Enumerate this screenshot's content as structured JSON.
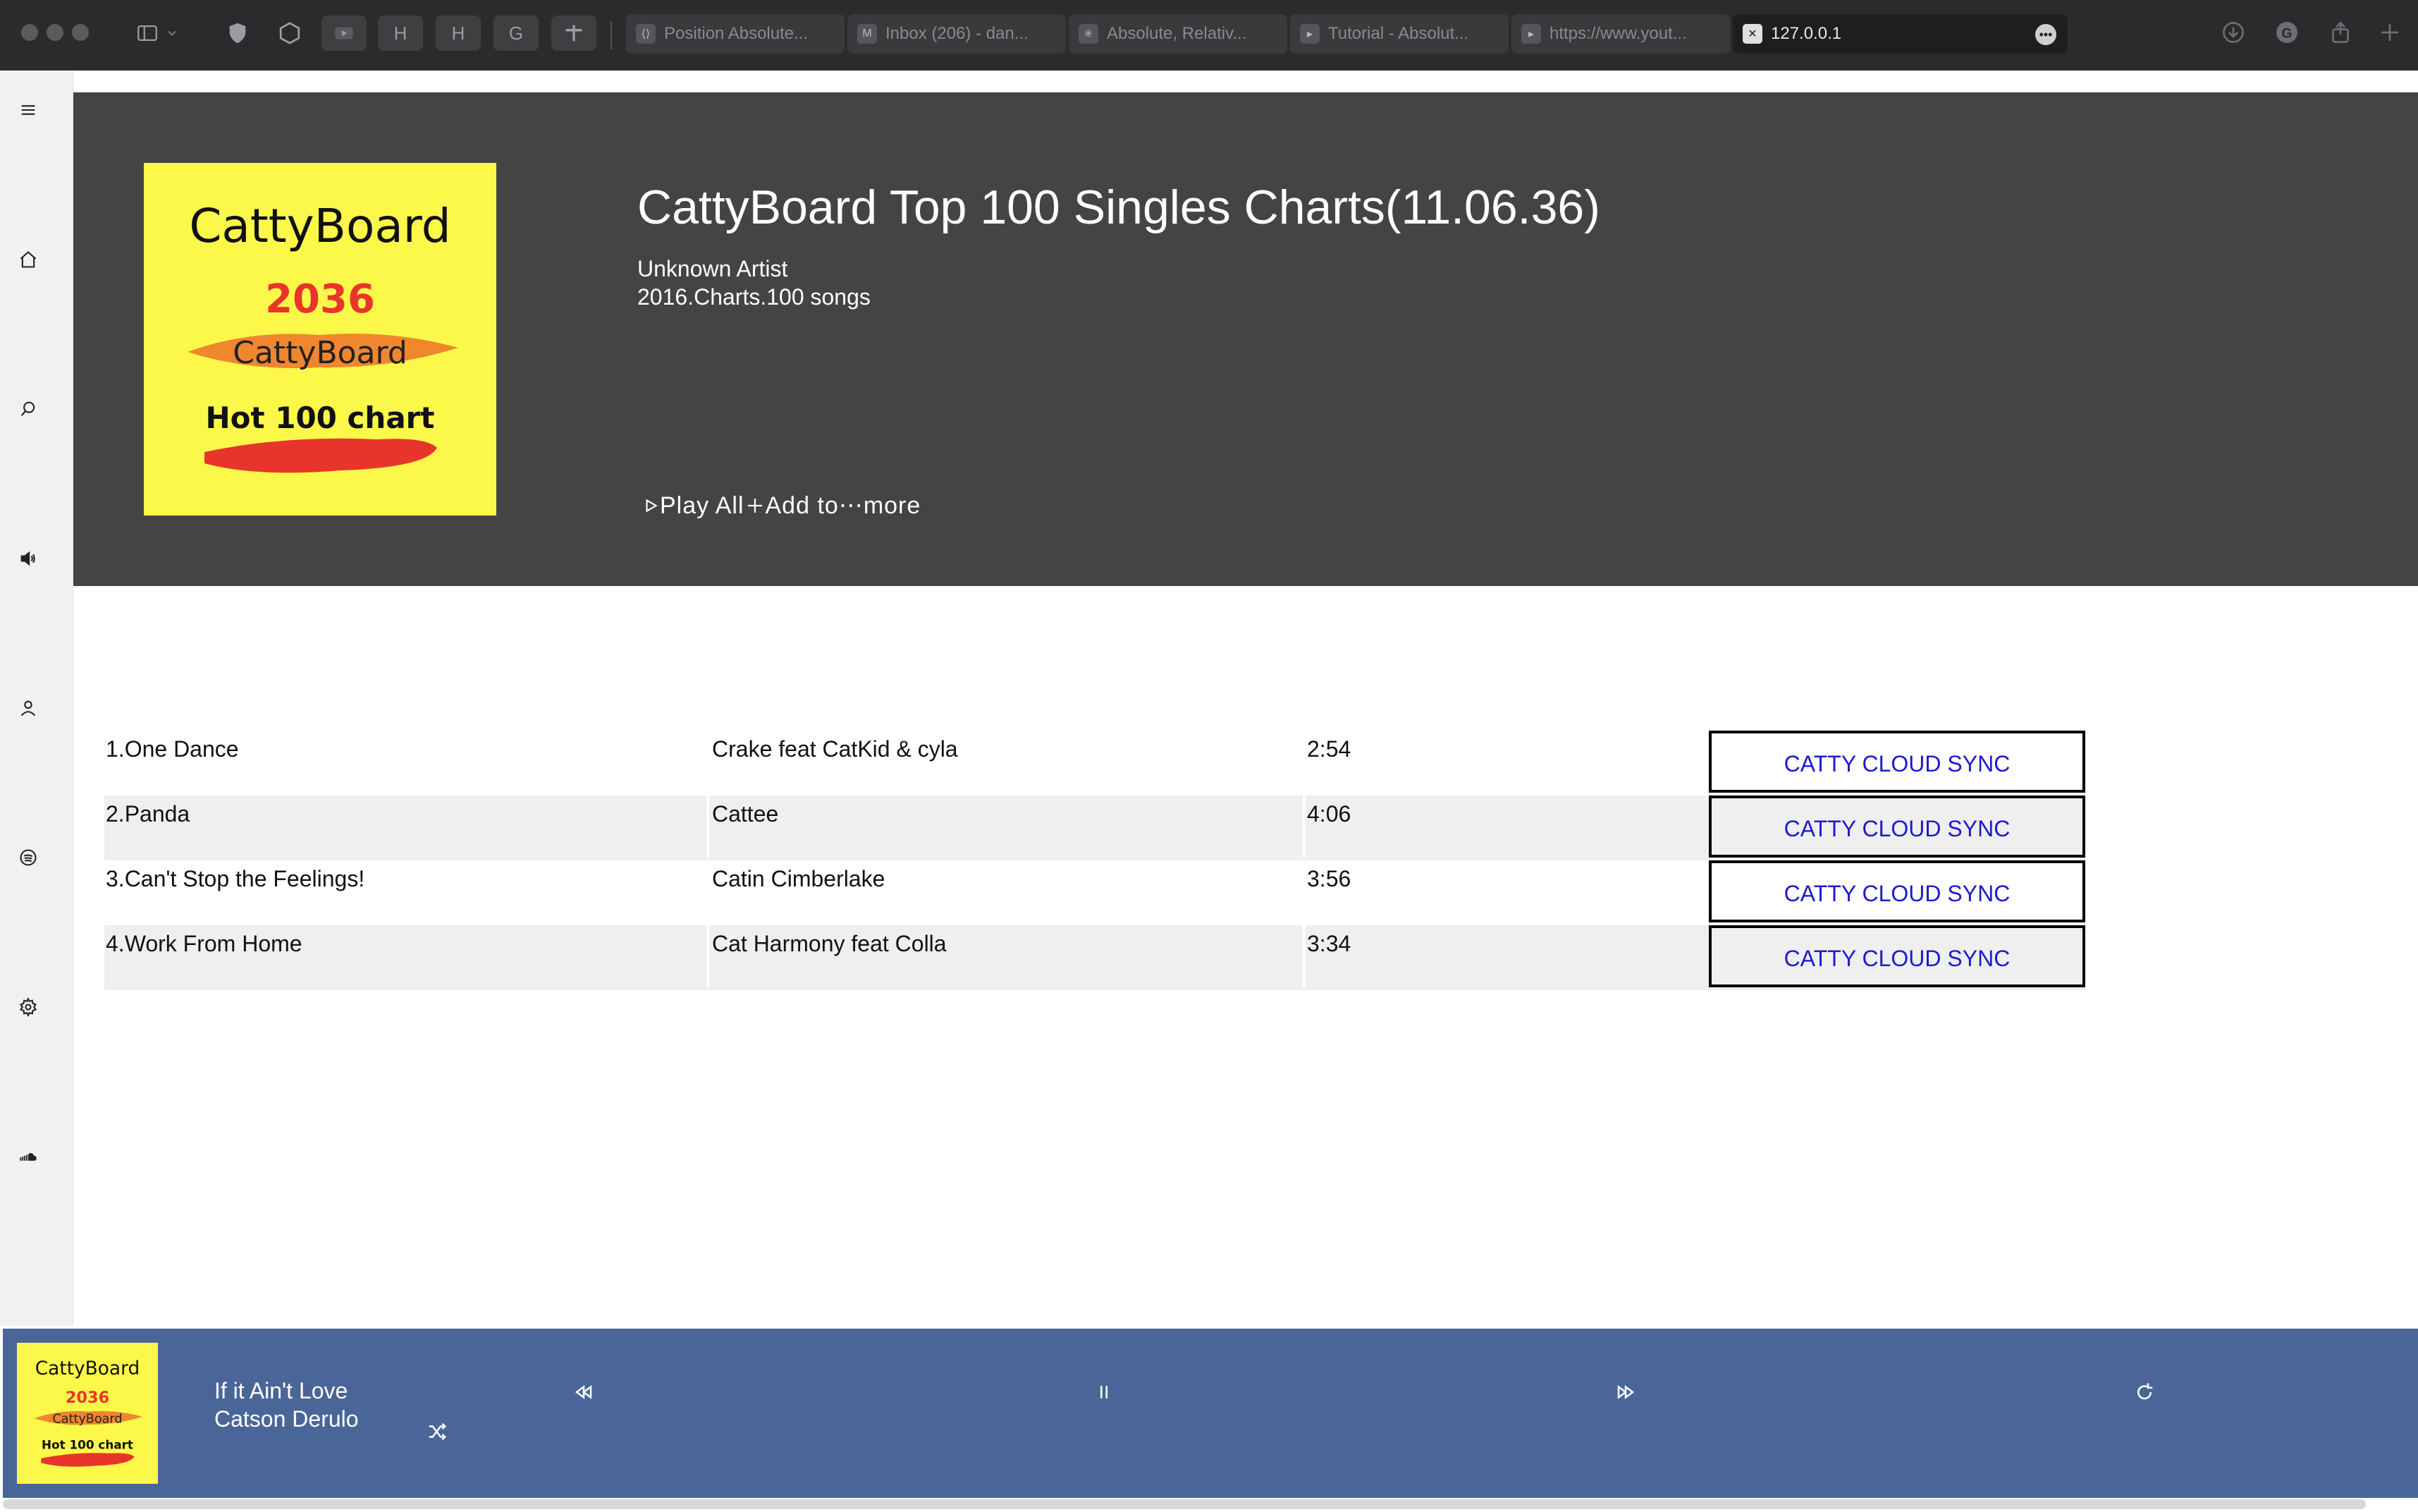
{
  "browser": {
    "tabs": [
      {
        "label": "Position Absolute...",
        "icon": "code-icon"
      },
      {
        "label": "Inbox (206) - dan...",
        "icon": "mail-icon"
      },
      {
        "label": "Absolute, Relativ...",
        "icon": "sparkle-icon"
      },
      {
        "label": "Tutorial - Absolut...",
        "icon": "video-icon"
      },
      {
        "label": "https://www.yout...",
        "icon": "video-icon"
      }
    ],
    "active_tab": {
      "label": "127.0.0.1",
      "icon": "close-icon"
    },
    "pinned": [
      "H",
      "H",
      "G"
    ]
  },
  "nav": [
    "menu-icon",
    "home-icon",
    "search-icon",
    "volume-icon",
    "user-icon",
    "spotify-icon",
    "settings-icon",
    "soundcloud-icon"
  ],
  "album": {
    "cover": {
      "line1": "CattyBoard",
      "line2": "2036",
      "line3": "CattyBoard",
      "line4": "Hot 100 chart"
    },
    "title": "CattyBoard Top 100 Singles Charts(11.06.36)",
    "artist": "Unknown Artist",
    "meta": "2016.Charts.100 songs",
    "actions": {
      "play_all": "Play All",
      "add_to": "Add to",
      "more": "more"
    }
  },
  "tracks": [
    {
      "title": "1.One Dance",
      "artist": "Crake feat CatKid & cyla",
      "duration": "2:54",
      "sync": "CATTY CLOUD SYNC"
    },
    {
      "title": "2.Panda",
      "artist": "Cattee",
      "duration": "4:06",
      "sync": "CATTY CLOUD SYNC"
    },
    {
      "title": "3.Can't Stop the Feelings!",
      "artist": "Catin Cimberlake",
      "duration": "3:56",
      "sync": "CATTY CLOUD SYNC"
    },
    {
      "title": "4.Work From Home",
      "artist": "Cat Harmony feat Colla",
      "duration": "3:34",
      "sync": "CATTY CLOUD SYNC"
    }
  ],
  "player": {
    "title": "If it Ain't Love",
    "artist": "Catson Derulo",
    "controls": [
      "shuffle-icon",
      "rewind-icon",
      "pause-icon",
      "fast-forward-icon",
      "repeat-icon"
    ]
  },
  "colors": {
    "hero_bg": "#444444",
    "player_bg": "#4a6698",
    "cover_yellow": "#fbf84a",
    "link_blue": "#1b1bd0"
  }
}
